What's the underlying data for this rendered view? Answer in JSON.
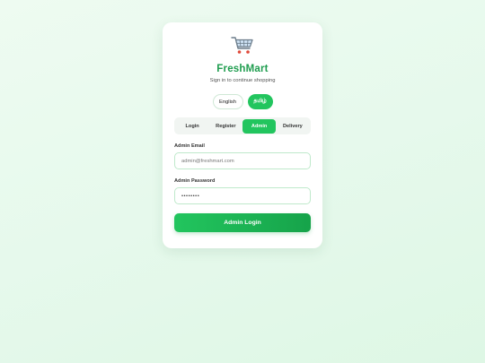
{
  "brand": {
    "logo_icon": "shopping-cart-icon",
    "name": "FreshMart",
    "subtitle": "Sign in to continue shopping"
  },
  "language": {
    "options": [
      "English",
      "தமிழ்"
    ],
    "selected": "தமிழ்"
  },
  "tabs": {
    "items": [
      "Login",
      "Register",
      "Admin",
      "Delivery"
    ],
    "active": "Admin"
  },
  "form": {
    "email_label": "Admin Email",
    "email_placeholder": "admin@freshmart.com",
    "password_label": "Admin Password",
    "password_value": "••••••••",
    "submit_label": "Admin Login"
  },
  "colors": {
    "accent": "#22c55e",
    "brand_text": "#1f9d4f",
    "background": "#e6f9ec"
  }
}
